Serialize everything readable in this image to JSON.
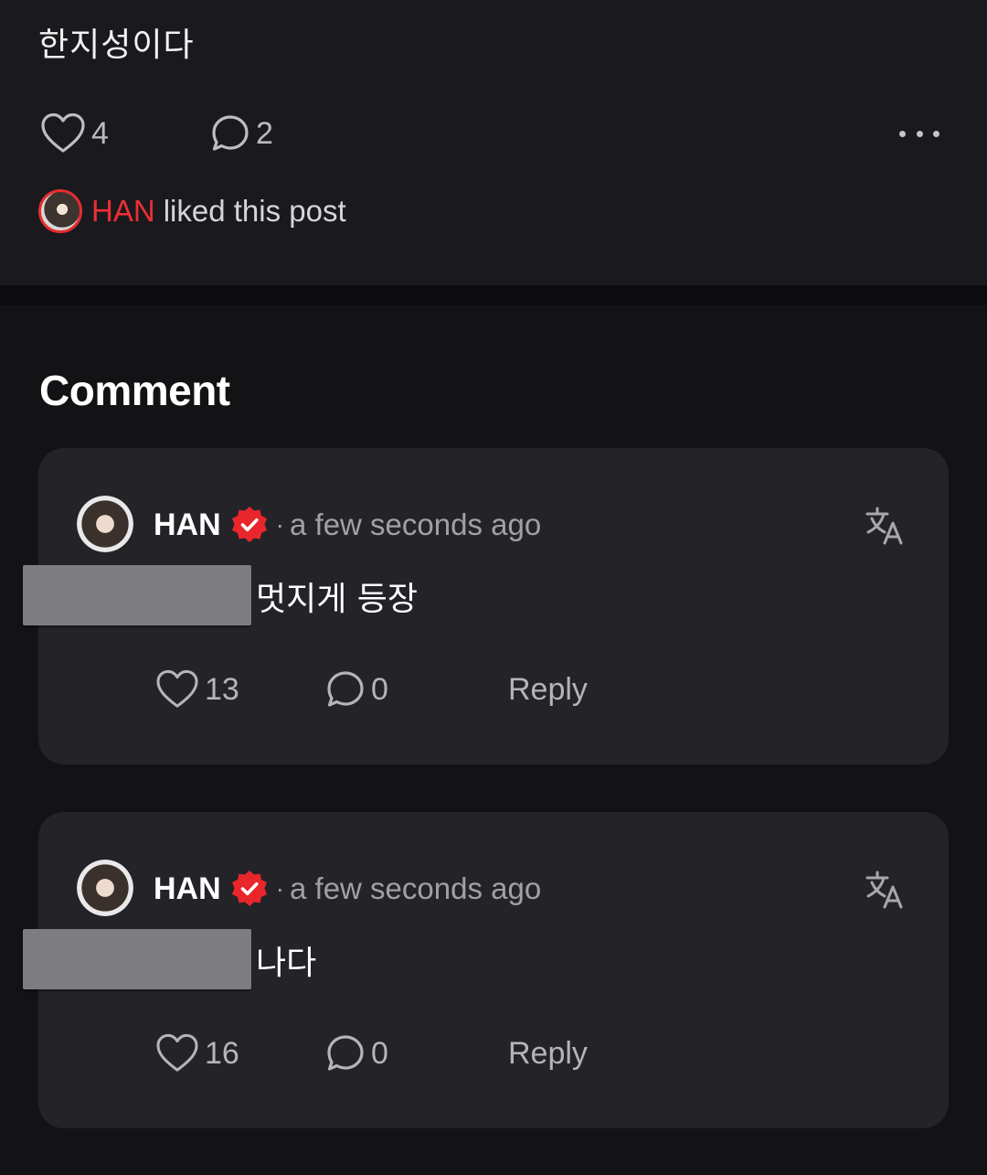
{
  "post": {
    "text": "한지성이다",
    "likes": "4",
    "comments": "2",
    "liked_by": {
      "name": "HAN",
      "suffix": "liked this post"
    }
  },
  "colors": {
    "accent": "#ec2f34",
    "background": "#131316",
    "card": "#232328",
    "muted_text": "#a0a0a6"
  },
  "icons": {
    "like": "heart-outline",
    "comment": "speech-bubble-outline",
    "more": "three-dots-horizontal",
    "verified": "verified-badge",
    "translate": "translate"
  },
  "comments_section": {
    "title": "Comment",
    "items": [
      {
        "author": "HAN",
        "separator": "·",
        "time": "a few seconds ago",
        "text": "멋지게 등장",
        "likes": "13",
        "replies": "0",
        "reply_label": "Reply"
      },
      {
        "author": "HAN",
        "separator": "·",
        "time": "a few seconds ago",
        "text": "나다",
        "likes": "16",
        "replies": "0",
        "reply_label": "Reply"
      }
    ]
  }
}
